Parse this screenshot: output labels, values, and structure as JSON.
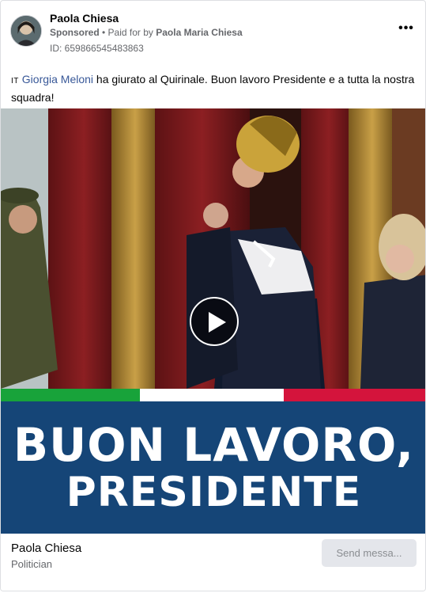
{
  "advertiser": {
    "name": "Paola Chiesa",
    "sponsored_label": "Sponsored",
    "separator": " • ",
    "paid_for_prefix": "Paid for by ",
    "paid_for_name": "Paola Maria Chiesa",
    "ad_id": "ID: 659866545483863",
    "more_label": "•••"
  },
  "post": {
    "flag_text": "IT",
    "mention": "Giorgia Meloni",
    "body": " ha giurato al Quirinale. Buon lavoro Presidente e a tutta la nostra squadra!"
  },
  "media": {
    "video_player": "play-icon",
    "banner_line1": "BUON LAVORO,",
    "banner_line2": "PRESIDENTE",
    "stripe_colors": [
      "#18a33a",
      "#ffffff",
      "#d4143c"
    ],
    "banner_color": "#154577"
  },
  "footer": {
    "page_name": "Paola Chiesa",
    "page_category": "Politician",
    "cta_label": "Send messa..."
  }
}
